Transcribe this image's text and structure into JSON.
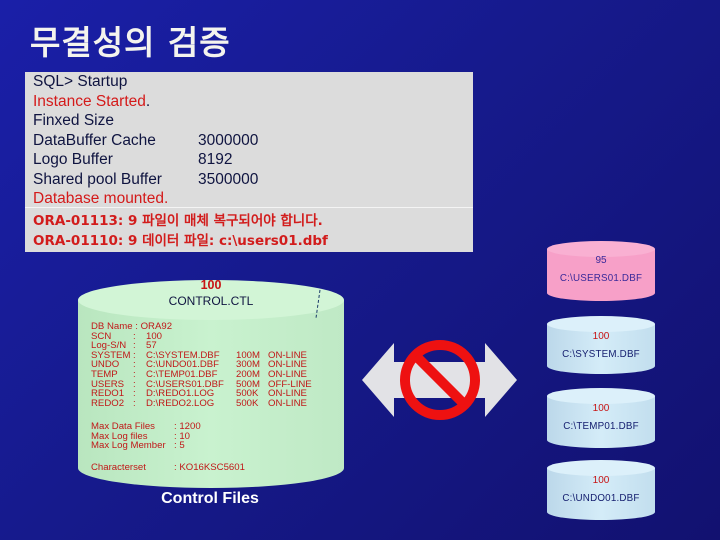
{
  "title": "무결성의 검증",
  "console": {
    "lines": [
      {
        "text": "SQL> Startup",
        "value": ""
      },
      {
        "text": "Instance Started",
        "suffix": ".",
        "value": ""
      },
      {
        "text": "Finxed Size",
        "value": ""
      },
      {
        "text": "DataBuffer Cache",
        "value": "3000000"
      },
      {
        "text": "Logo Buffer",
        "value": "8192"
      },
      {
        "text": "Shared pool Buffer",
        "value": "3500000"
      },
      {
        "text": "Database mounted.",
        "value": ""
      }
    ],
    "errors": [
      "ORA-01113: 9  파일이 매체 복구되어야 합니다.",
      "ORA-01110: 9 데이터 파일: c:\\users01.dbf"
    ]
  },
  "control_file": {
    "scn": "100",
    "name": "CONTROL.CTL",
    "db_name_line": "DB Name : ORA92",
    "entries": [
      {
        "key": "SCN",
        "sep": ":",
        "file": "100",
        "size": "",
        "status": ""
      },
      {
        "key": "Log-S/N",
        "sep": ":",
        "file": "57",
        "size": "",
        "status": ""
      },
      {
        "key": "SYSTEM",
        "sep": ":",
        "file": "C:\\SYSTEM.DBF",
        "size": "100M",
        "status": "ON-LINE"
      },
      {
        "key": "UNDO",
        "sep": ":",
        "file": "C:\\UNDO01.DBF",
        "size": "300M",
        "status": "ON-LINE"
      },
      {
        "key": "TEMP",
        "sep": ":",
        "file": "C:\\TEMP01.DBF",
        "size": "200M",
        "status": "ON-LINE"
      },
      {
        "key": "USERS",
        "sep": ":",
        "file": "C:\\USERS01.DBF",
        "size": "500M",
        "status": "OFF-LINE"
      },
      {
        "key": "REDO1",
        "sep": ":",
        "file": "D:\\REDO1.LOG",
        "size": "500K",
        "status": "ON-LINE"
      },
      {
        "key": "REDO2",
        "sep": ":",
        "file": "D:\\REDO2.LOG",
        "size": "500K",
        "status": "ON-LINE"
      }
    ],
    "limits": [
      {
        "key": "Max Data Files",
        "value": ": 1200"
      },
      {
        "key": "Max Log files",
        "value": ": 10"
      },
      {
        "key": "Max Log Member",
        "value": ": 5"
      }
    ],
    "charset": {
      "key": "Characterset",
      "value": ": KO16KSC5601"
    },
    "caption": "Control Files"
  },
  "data_files": [
    {
      "scn": "95",
      "file": "C:\\USERS01.DBF",
      "state": "mismatch"
    },
    {
      "scn": "100",
      "file": "C:\\SYSTEM.DBF",
      "state": "ok"
    },
    {
      "scn": "100",
      "file": "C:\\TEMP01.DBF",
      "state": "ok"
    },
    {
      "scn": "100",
      "file": "C:\\UNDO01.DBF",
      "state": "ok"
    }
  ],
  "colors": {
    "ok_cylinder": "#cfe6f2",
    "mismatch_cylinder": "#f7a0c8",
    "control_cylinder": "#c6efcc",
    "prohibit": "#ee1111",
    "error_text": "#d21c1c"
  }
}
